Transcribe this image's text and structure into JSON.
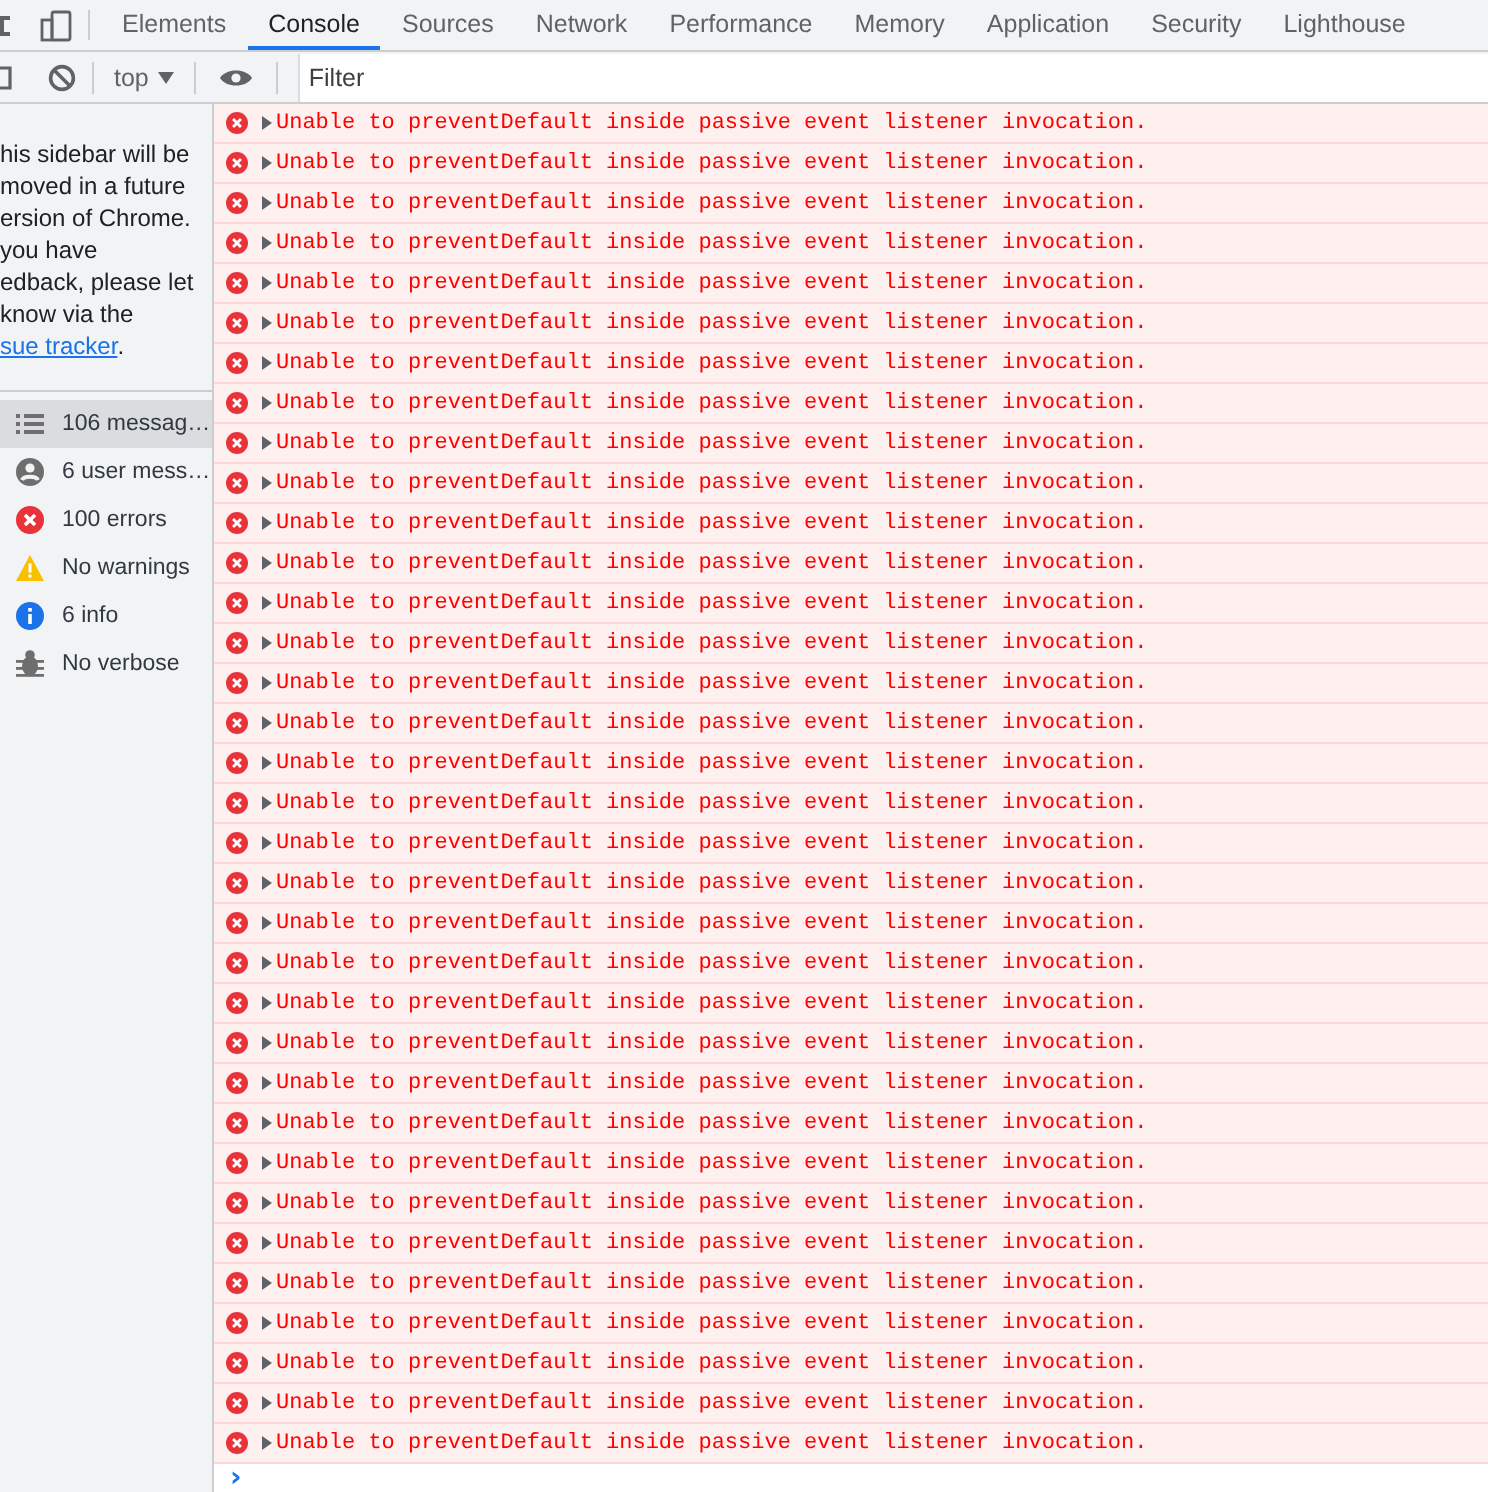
{
  "tabs": [
    {
      "label": "Elements",
      "selected": false
    },
    {
      "label": "Console",
      "selected": true
    },
    {
      "label": "Sources",
      "selected": false
    },
    {
      "label": "Network",
      "selected": false
    },
    {
      "label": "Performance",
      "selected": false
    },
    {
      "label": "Memory",
      "selected": false
    },
    {
      "label": "Application",
      "selected": false
    },
    {
      "label": "Security",
      "selected": false
    },
    {
      "label": "Lighthouse",
      "selected": false
    }
  ],
  "toolbar": {
    "context": "top",
    "filter": {
      "placeholder": "Filter"
    }
  },
  "sidebar": {
    "notice": {
      "lines": [
        "his sidebar will be",
        "moved in a future",
        "ersion of Chrome.",
        "you have",
        "edback, please let",
        "know via the"
      ],
      "link": "sue tracker",
      "end": "."
    },
    "items": [
      {
        "kind": "messages",
        "label": "106 messag…",
        "selected": true
      },
      {
        "kind": "user",
        "label": "6 user mess…",
        "selected": false
      },
      {
        "kind": "errors",
        "label": "100 errors",
        "selected": false
      },
      {
        "kind": "warnings",
        "label": "No warnings",
        "selected": false
      },
      {
        "kind": "info",
        "label": "6 info",
        "selected": false
      },
      {
        "kind": "verbose",
        "label": "No verbose",
        "selected": false
      }
    ]
  },
  "messages": [
    {
      "kind": "error",
      "text": "Unable to preventDefault inside passive event listener invocation."
    },
    {
      "kind": "error",
      "text": "Unable to preventDefault inside passive event listener invocation."
    },
    {
      "kind": "error",
      "text": "Unable to preventDefault inside passive event listener invocation."
    },
    {
      "kind": "error",
      "text": "Unable to preventDefault inside passive event listener invocation."
    },
    {
      "kind": "error",
      "text": "Unable to preventDefault inside passive event listener invocation."
    },
    {
      "kind": "error",
      "text": "Unable to preventDefault inside passive event listener invocation."
    },
    {
      "kind": "error",
      "text": "Unable to preventDefault inside passive event listener invocation."
    },
    {
      "kind": "error",
      "text": "Unable to preventDefault inside passive event listener invocation."
    },
    {
      "kind": "error",
      "text": "Unable to preventDefault inside passive event listener invocation."
    },
    {
      "kind": "error",
      "text": "Unable to preventDefault inside passive event listener invocation."
    },
    {
      "kind": "error",
      "text": "Unable to preventDefault inside passive event listener invocation."
    },
    {
      "kind": "error",
      "text": "Unable to preventDefault inside passive event listener invocation."
    },
    {
      "kind": "error",
      "text": "Unable to preventDefault inside passive event listener invocation."
    },
    {
      "kind": "error",
      "text": "Unable to preventDefault inside passive event listener invocation."
    },
    {
      "kind": "error",
      "text": "Unable to preventDefault inside passive event listener invocation."
    },
    {
      "kind": "error",
      "text": "Unable to preventDefault inside passive event listener invocation."
    },
    {
      "kind": "error",
      "text": "Unable to preventDefault inside passive event listener invocation."
    },
    {
      "kind": "error",
      "text": "Unable to preventDefault inside passive event listener invocation."
    },
    {
      "kind": "error",
      "text": "Unable to preventDefault inside passive event listener invocation."
    },
    {
      "kind": "error",
      "text": "Unable to preventDefault inside passive event listener invocation."
    },
    {
      "kind": "error",
      "text": "Unable to preventDefault inside passive event listener invocation."
    },
    {
      "kind": "error",
      "text": "Unable to preventDefault inside passive event listener invocation."
    },
    {
      "kind": "error",
      "text": "Unable to preventDefault inside passive event listener invocation."
    },
    {
      "kind": "error",
      "text": "Unable to preventDefault inside passive event listener invocation."
    },
    {
      "kind": "error",
      "text": "Unable to preventDefault inside passive event listener invocation."
    },
    {
      "kind": "error",
      "text": "Unable to preventDefault inside passive event listener invocation."
    },
    {
      "kind": "error",
      "text": "Unable to preventDefault inside passive event listener invocation."
    },
    {
      "kind": "error",
      "text": "Unable to preventDefault inside passive event listener invocation."
    },
    {
      "kind": "error",
      "text": "Unable to preventDefault inside passive event listener invocation."
    },
    {
      "kind": "error",
      "text": "Unable to preventDefault inside passive event listener invocation."
    },
    {
      "kind": "error",
      "text": "Unable to preventDefault inside passive event listener invocation."
    },
    {
      "kind": "error",
      "text": "Unable to preventDefault inside passive event listener invocation."
    },
    {
      "kind": "error",
      "text": "Unable to preventDefault inside passive event listener invocation."
    },
    {
      "kind": "error",
      "text": "Unable to preventDefault inside passive event listener invocation."
    }
  ],
  "prompt": {
    "symbol": "›"
  }
}
